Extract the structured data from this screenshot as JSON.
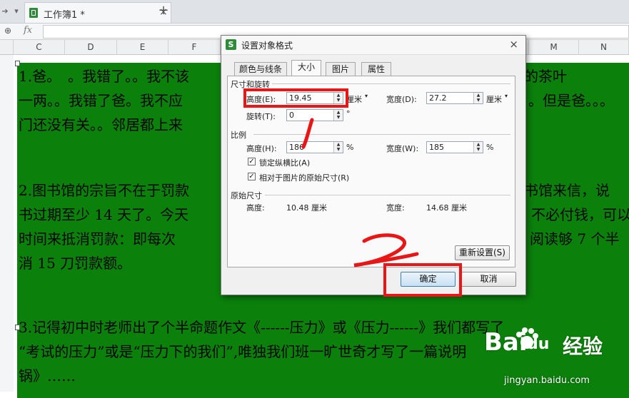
{
  "tabbar": {
    "doc_title": "工作簿1 *",
    "close_glyph": "×",
    "new_tab_glyph": "+"
  },
  "formula_bar": {
    "fx_label": "fx",
    "zoom_glyph": "⊕"
  },
  "columns": [
    "C",
    "D",
    "E",
    "F",
    "G",
    "H",
    "I",
    "J",
    "K",
    "L",
    "M",
    "N"
  ],
  "document_text": {
    "p1": [
      "1.爸。　。我错了。。我不该",
      "知道你的茶叶",
      "一两。。我错了爸。我不应",
      "。但是爸。。。",
      "门还没有关。。邻居都上来"
    ],
    "p2": [
      "2.图书馆的宗旨不在于罚款",
      "图书馆来信，说",
      "书过期至少 14 天了。今天",
      "不必付钱，可以",
      "时间来抵消罚款：即每次",
      "阅读够 7 个半",
      "消 15 刀罚款额。"
    ],
    "p3": [
      "3.记得初中时老师出了个半命题作文《------压力》或《压力------》我们都写了",
      "“考试的压力”或是“压力下的我们”,唯独我们班一旷世奇才写了一篇说明",
      "锅》……"
    ]
  },
  "dialog": {
    "title": "设置对象格式",
    "close_glyph": "×",
    "tabs": [
      {
        "label": "颜色与线条",
        "active": false
      },
      {
        "label": "大小",
        "active": true
      },
      {
        "label": "图片",
        "active": false
      },
      {
        "label": "属性",
        "active": false
      }
    ],
    "size_section": {
      "title": "尺寸和旋转",
      "height_label": "高度(E):",
      "height_value": "19.45",
      "height_unit": "厘米",
      "width_label": "宽度(D):",
      "width_value": "27.2",
      "width_unit": "厘米",
      "rotate_label": "旋转(T):",
      "rotate_value": "0",
      "rotate_unit": "°"
    },
    "scale_section": {
      "title": "比例",
      "height_label": "高度(H):",
      "height_value": "186",
      "height_unit": "%",
      "width_label": "宽度(W):",
      "width_value": "185",
      "width_unit": "%",
      "lock_ratio_label": "锁定纵横比(A)",
      "lock_ratio_checked": true,
      "relative_label": "相对于图片的原始尺寸(R)",
      "relative_checked": true
    },
    "original_section": {
      "title": "原始尺寸",
      "height_label": "高度:",
      "height_value": "10.48 厘米",
      "width_label": "宽度:",
      "width_value": "14.68 厘米"
    },
    "reset_button": "重新设置(S)",
    "ok_button": "确定",
    "cancel_button": "取消"
  },
  "annotations": {
    "mark1": "1",
    "mark2": "2",
    "color": "#e81616"
  },
  "watermark": {
    "brand_left": "Bai",
    "brand_mid": "du",
    "brand_right": "经验",
    "url": "jingyan.baidu.com"
  }
}
